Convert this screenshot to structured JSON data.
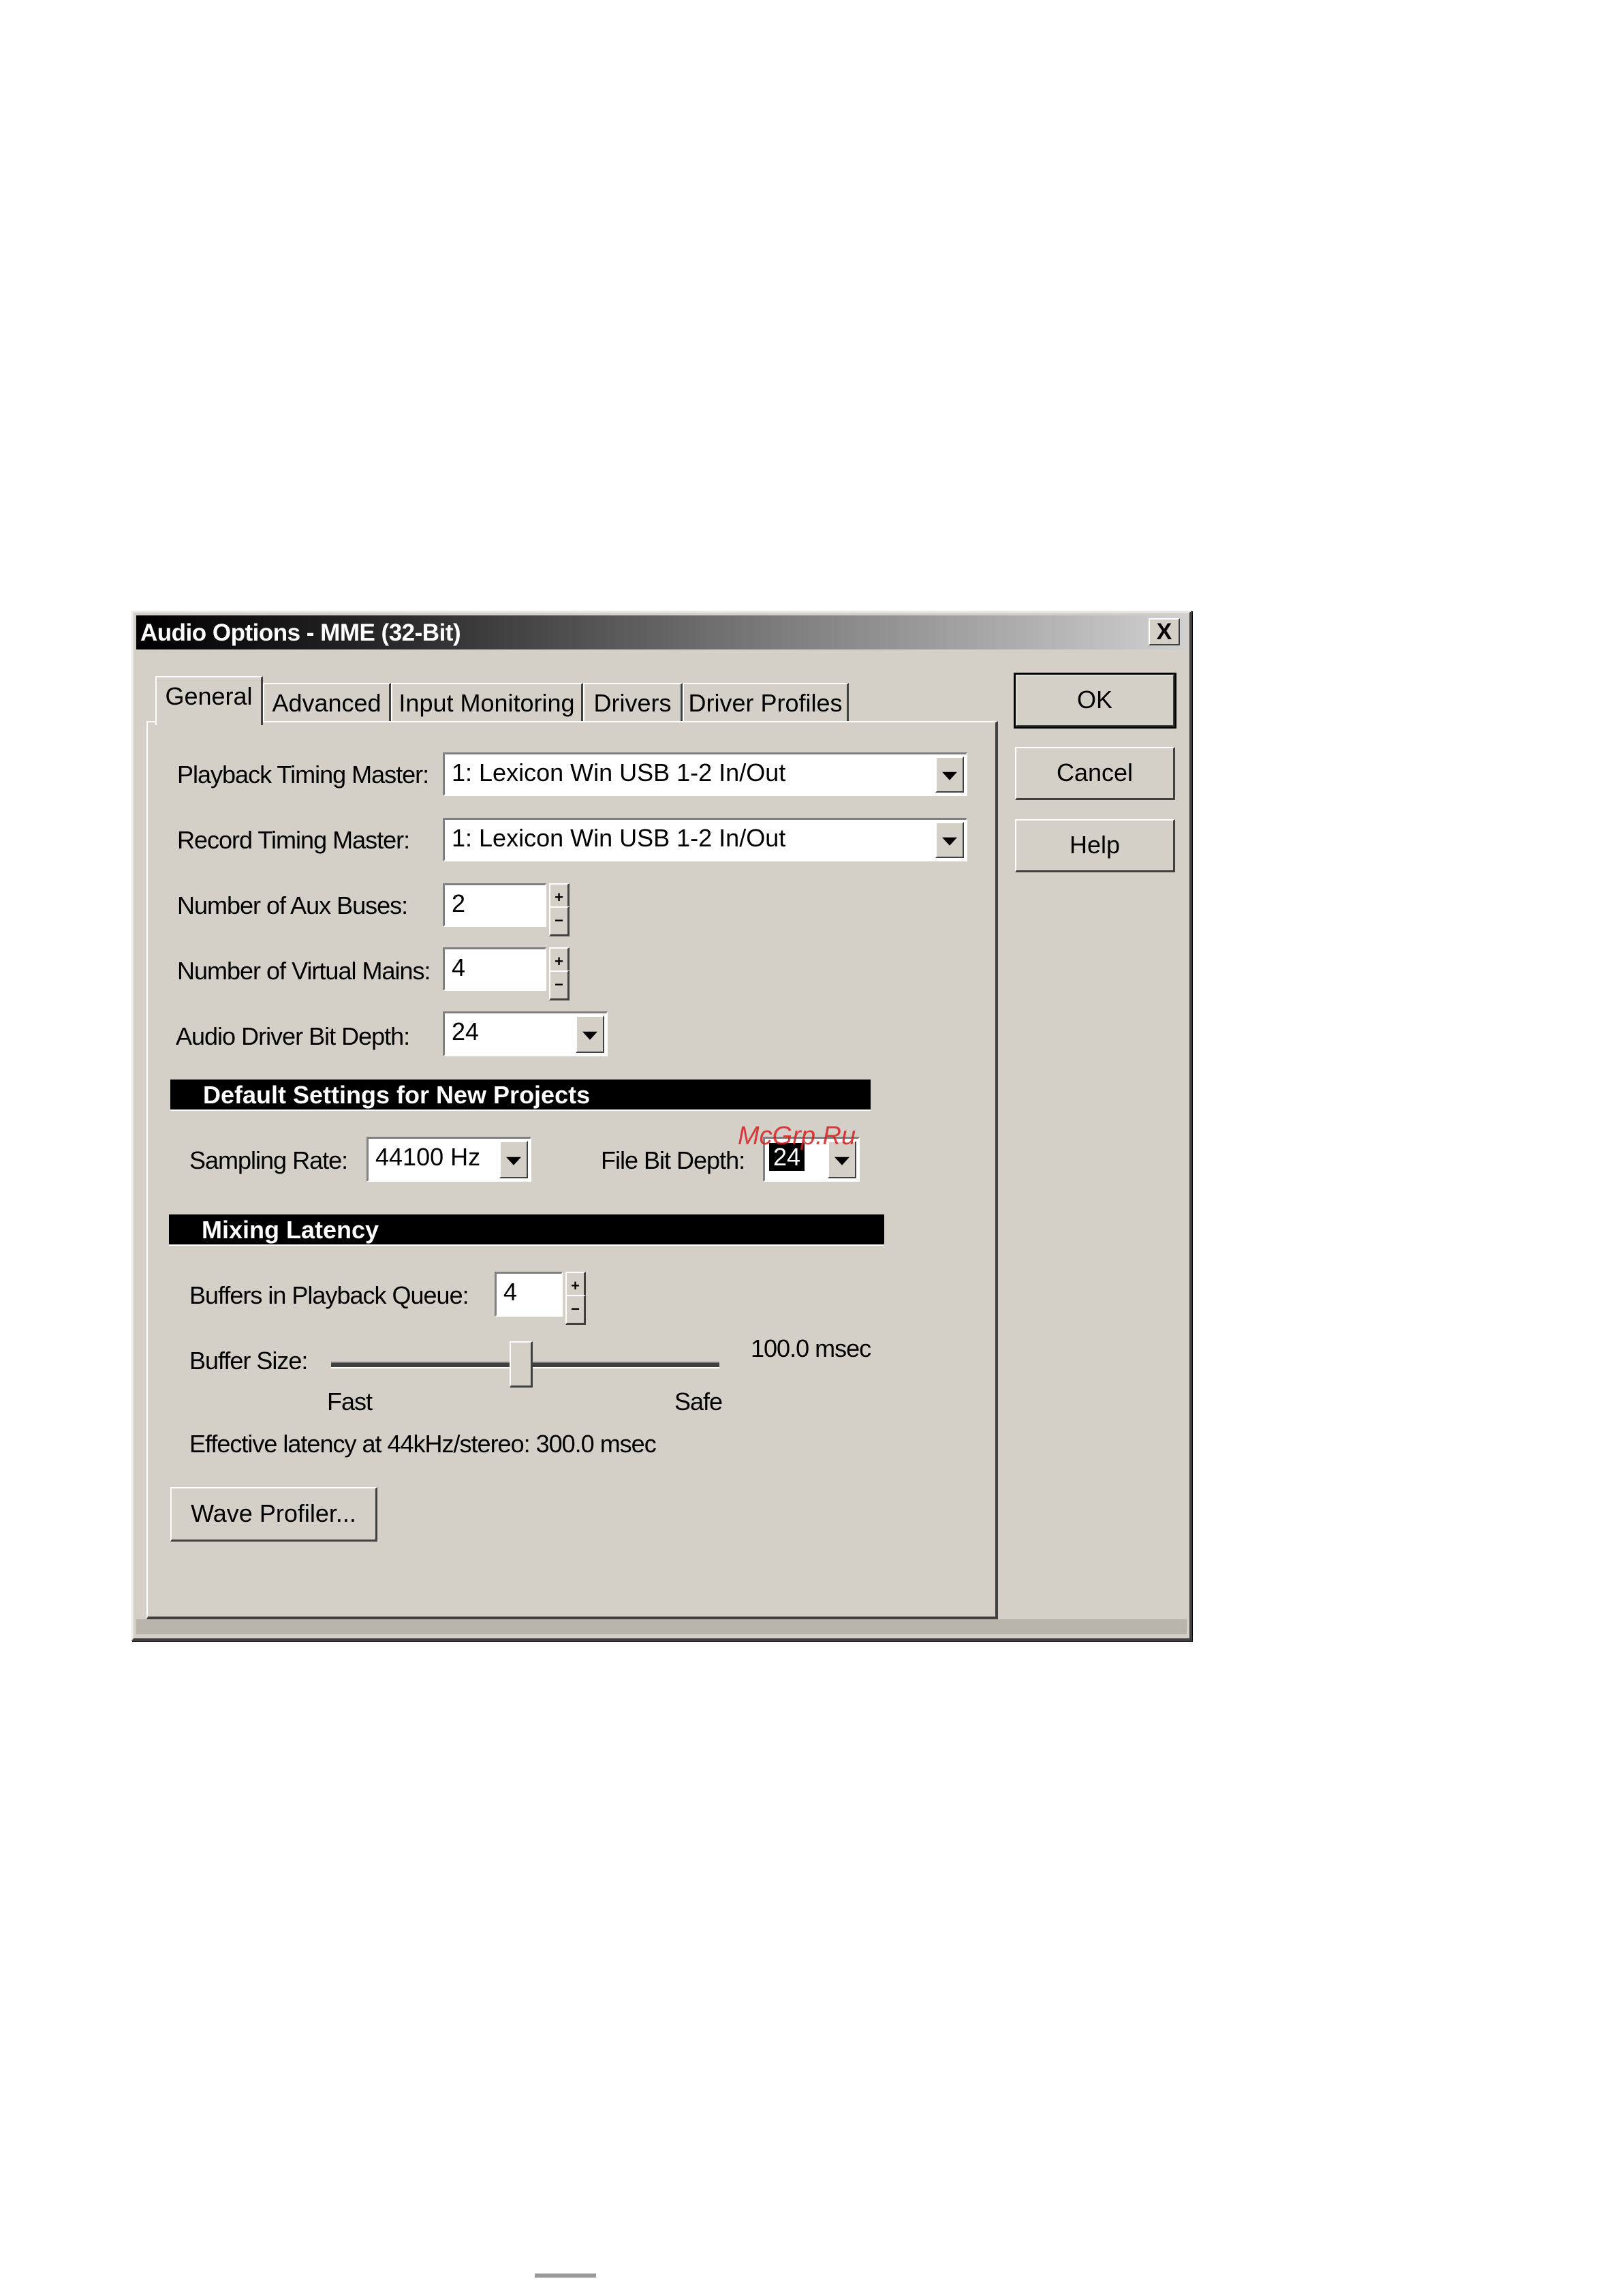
{
  "window": {
    "title": "Audio Options - MME (32-Bit)",
    "close_label": "X"
  },
  "buttons": {
    "ok": "OK",
    "cancel": "Cancel",
    "help": "Help",
    "wave_profiler": "Wave Profiler..."
  },
  "tabs": [
    {
      "label": "General",
      "active": true
    },
    {
      "label": "Advanced",
      "active": false
    },
    {
      "label": "Input Monitoring",
      "active": false
    },
    {
      "label": "Drivers",
      "active": false
    },
    {
      "label": "Driver Profiles",
      "active": false
    }
  ],
  "general": {
    "playback_timing_master": {
      "label": "Playback Timing Master:",
      "value": "1: Lexicon Win USB 1-2 In/Out"
    },
    "record_timing_master": {
      "label": "Record Timing Master:",
      "value": "1: Lexicon Win USB 1-2 In/Out"
    },
    "aux_buses": {
      "label": "Number of Aux Buses:",
      "value": "2"
    },
    "virtual_mains": {
      "label": "Number of Virtual Mains:",
      "value": "4"
    },
    "driver_bit_depth": {
      "label": "Audio Driver Bit Depth:",
      "value": "24"
    }
  },
  "defaults": {
    "heading": "Default Settings for New Projects",
    "sampling_rate": {
      "label": "Sampling Rate:",
      "value": "44100 Hz"
    },
    "file_bit_depth": {
      "label": "File Bit Depth:",
      "value": "24"
    }
  },
  "latency": {
    "heading": "Mixing Latency",
    "buffers": {
      "label": "Buffers in Playback Queue:",
      "value": "4"
    },
    "buffer_size": {
      "label": "Buffer Size:",
      "value_text": "100.0 msec",
      "min_label": "Fast",
      "max_label": "Safe",
      "position": 0.49
    },
    "effective": "Effective latency at 44kHz/stereo:  300.0 msec"
  },
  "spinner": {
    "up": "+",
    "down": "−"
  },
  "watermark": "McGrp.Ru"
}
